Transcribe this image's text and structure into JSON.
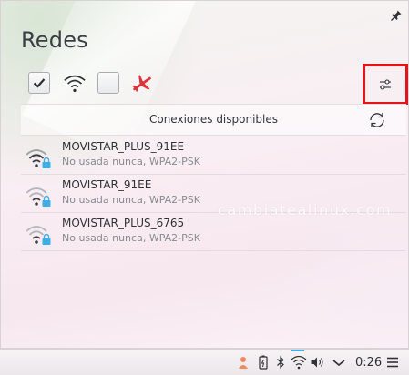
{
  "popup": {
    "title": "Redes",
    "toolbar": {
      "wired_checkbox": "checked",
      "wifi_checkbox": "unchecked",
      "airplane_color": "#e0323b",
      "settings_highlight_color": "#e4141b"
    },
    "connections_header": "Conexiones disponibles",
    "networks": [
      {
        "name": "MOVISTAR_PLUS_91EE",
        "status": "No usada nunca, WPA2-PSK"
      },
      {
        "name": "MOVISTAR_91EE",
        "status": "No usada nunca, WPA2-PSK"
      },
      {
        "name": "MOVISTAR_PLUS_6765",
        "status": "No usada nunca, WPA2-PSK"
      }
    ],
    "watermark": "cambiatealinux.com"
  },
  "taskbar": {
    "clock": "0:26",
    "tray_icons": [
      "user-icon",
      "battery-icon",
      "bluetooth-icon",
      "wifi-icon",
      "volume-icon",
      "chevron-down-icon",
      "menu-icon"
    ]
  }
}
